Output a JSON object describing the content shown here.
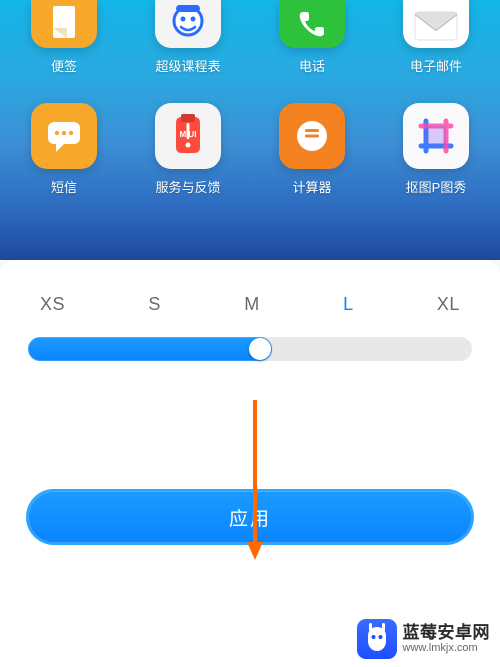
{
  "apps": {
    "row1": [
      {
        "name": "bianqian",
        "label": "便签"
      },
      {
        "name": "kechengbiao",
        "label": "超级课程表"
      },
      {
        "name": "dianhua",
        "label": "电话"
      },
      {
        "name": "youjian",
        "label": "电子邮件"
      }
    ],
    "row2": [
      {
        "name": "duanxin",
        "label": "短信"
      },
      {
        "name": "fuwu",
        "label": "服务与反馈"
      },
      {
        "name": "jisuanqi",
        "label": "计算器"
      },
      {
        "name": "koutu",
        "label": "抠图P图秀"
      }
    ]
  },
  "icon_size": {
    "options": [
      "XS",
      "S",
      "M",
      "L",
      "XL"
    ],
    "selected_index": 3,
    "slider_percent": 55
  },
  "miui_badge": "MIUI",
  "apply_button": "应用",
  "watermark": {
    "title": "蓝莓安卓网",
    "url": "www.lmkjx.com"
  },
  "colors": {
    "accent": "#0a84ff",
    "orange": "#f7a72a",
    "green": "#2ec23c",
    "arrow": "#ff6a00"
  }
}
